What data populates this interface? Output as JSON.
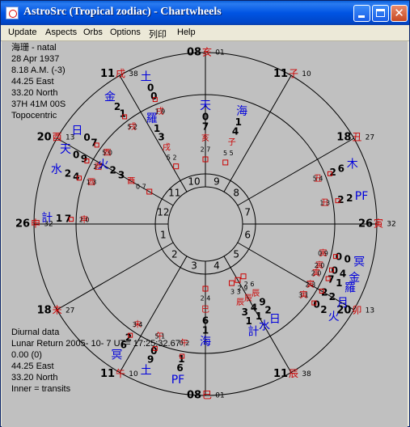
{
  "window": {
    "title": "AstroSrc (Tropical zodiac) - Chartwheels",
    "min_symbol": "_",
    "max_symbol": "□",
    "close_symbol": "✕"
  },
  "menu": [
    "Update",
    "Aspects",
    "Orbs",
    "Options",
    "列印",
    "Help"
  ],
  "header_info": [
    "海珊 - natal",
    "28 Apr 1937",
    "8.18 A.M. (-3)",
    "44.25 East",
    "33.20 North",
    "37H 41M 00S",
    "Topocentric"
  ],
  "footer_info": [
    "Diurnal data",
    "Lunar Return 2005- 10- 7 UT= 17:25:32.67",
    "0.00   (0)",
    "44.25 East",
    "33.20 North",
    "Inner = transits"
  ],
  "house_numbers": [
    "1",
    "2",
    "3",
    "4",
    "5",
    "6",
    "7",
    "8",
    "9",
    "10",
    "11",
    "12"
  ],
  "cusps": [
    {
      "deg": "08",
      "sign": "亥",
      "min": "01"
    },
    {
      "deg": "11",
      "sign": "子",
      "min": "10"
    },
    {
      "deg": "18",
      "sign": "丑",
      "min": "27"
    },
    {
      "deg": "26",
      "sign": "寅",
      "min": "32"
    },
    {
      "deg": "20",
      "sign": "卯",
      "min": "13"
    },
    {
      "deg": "11",
      "sign": "辰",
      "min": "38"
    },
    {
      "deg": "08",
      "sign": "巳",
      "min": "01"
    },
    {
      "deg": "11",
      "sign": "午",
      "min": "10"
    },
    {
      "deg": "18",
      "sign": "未",
      "min": "27"
    },
    {
      "deg": "26",
      "sign": "申",
      "min": "32"
    },
    {
      "deg": "20",
      "sign": "酉",
      "min": "13"
    },
    {
      "deg": "11",
      "sign": "戌",
      "min": "38"
    }
  ],
  "outer_planets": [
    {
      "name": "土",
      "deg": "0",
      "min": "0",
      "sign": "戌",
      "sec": "1 9"
    },
    {
      "name": "金",
      "deg": "2",
      "min": "1",
      "sign": "戌",
      "sec": "5 2"
    },
    {
      "name": "日",
      "deg": "0",
      "min": "7",
      "sign": "酉",
      "sec": "5 0"
    },
    {
      "name": "天",
      "deg": "0",
      "min": "9",
      "sign": "酉",
      "sec": "2 7"
    },
    {
      "name": "水",
      "deg": "2",
      "min": "4",
      "sign": "酉",
      "sec": "1 3"
    },
    {
      "name": "計",
      "deg": "1",
      "min": "7",
      "sign": "申",
      "sec": "2 0"
    },
    {
      "name": "木",
      "deg": "6",
      "min": "2",
      "sign": "丑",
      "sec": "5 4"
    },
    {
      "name": "PF",
      "deg": "2",
      "min": "2",
      "sign": "丑",
      "sec": "1 3"
    },
    {
      "name": "冥",
      "deg": "0",
      "min": "0",
      "sign": "寅",
      "sec": "0 9"
    },
    {
      "name": "金",
      "deg": "4",
      "min": "0",
      "sign": "寅",
      "sec": "2 0"
    },
    {
      "name": "羅",
      "deg": "1",
      "min": "7",
      "sign": "寅",
      "sec": "2 0"
    },
    {
      "name": "月",
      "deg": "2",
      "min": "2",
      "sign": "寅",
      "sec": "2 3"
    },
    {
      "name": "火",
      "deg": "2",
      "min": "0",
      "sign": "寅",
      "sec": "3 1"
    },
    {
      "name": "冥",
      "deg": "6",
      "min": "2",
      "sign": "未",
      "sec": "3 4"
    },
    {
      "name": "土",
      "deg": "9",
      "min": "0",
      "sign": "午",
      "sec": "5 1"
    },
    {
      "name": "PF",
      "deg": "6",
      "min": "1",
      "sign": "午",
      "sec": "0 2"
    }
  ],
  "inner_planets": [
    {
      "name": "天",
      "deg": "0",
      "min": "7",
      "sign": "亥",
      "sec": "2 7"
    },
    {
      "name": "海",
      "deg": "1",
      "min": "4",
      "sign": "子",
      "sec": "5 5"
    },
    {
      "name": "羅",
      "deg": "1",
      "min": "3",
      "sign": "戌",
      "sec": "5 2"
    },
    {
      "name": "火",
      "deg": "2",
      "min": "3",
      "sign": "酉",
      "sec": "0 7"
    },
    {
      "name": "計",
      "deg": "1",
      "min": "3",
      "sign": "辰",
      "sec": "3 3"
    },
    {
      "name": "水",
      "deg": "1",
      "min": "4",
      "sign": "辰",
      "sec": "2 9"
    },
    {
      "name": "日",
      "deg": "2",
      "min": "9",
      "sign": "辰",
      "sec": "2 6"
    },
    {
      "name": "海",
      "deg": "1",
      "min": "6",
      "sign": "巳",
      "sec": "2 4"
    }
  ],
  "colors": {
    "planet": "#0000dd",
    "sign": "#cc0000",
    "line": "#000000",
    "bg": "#c0c0c0",
    "text": "#000000"
  }
}
